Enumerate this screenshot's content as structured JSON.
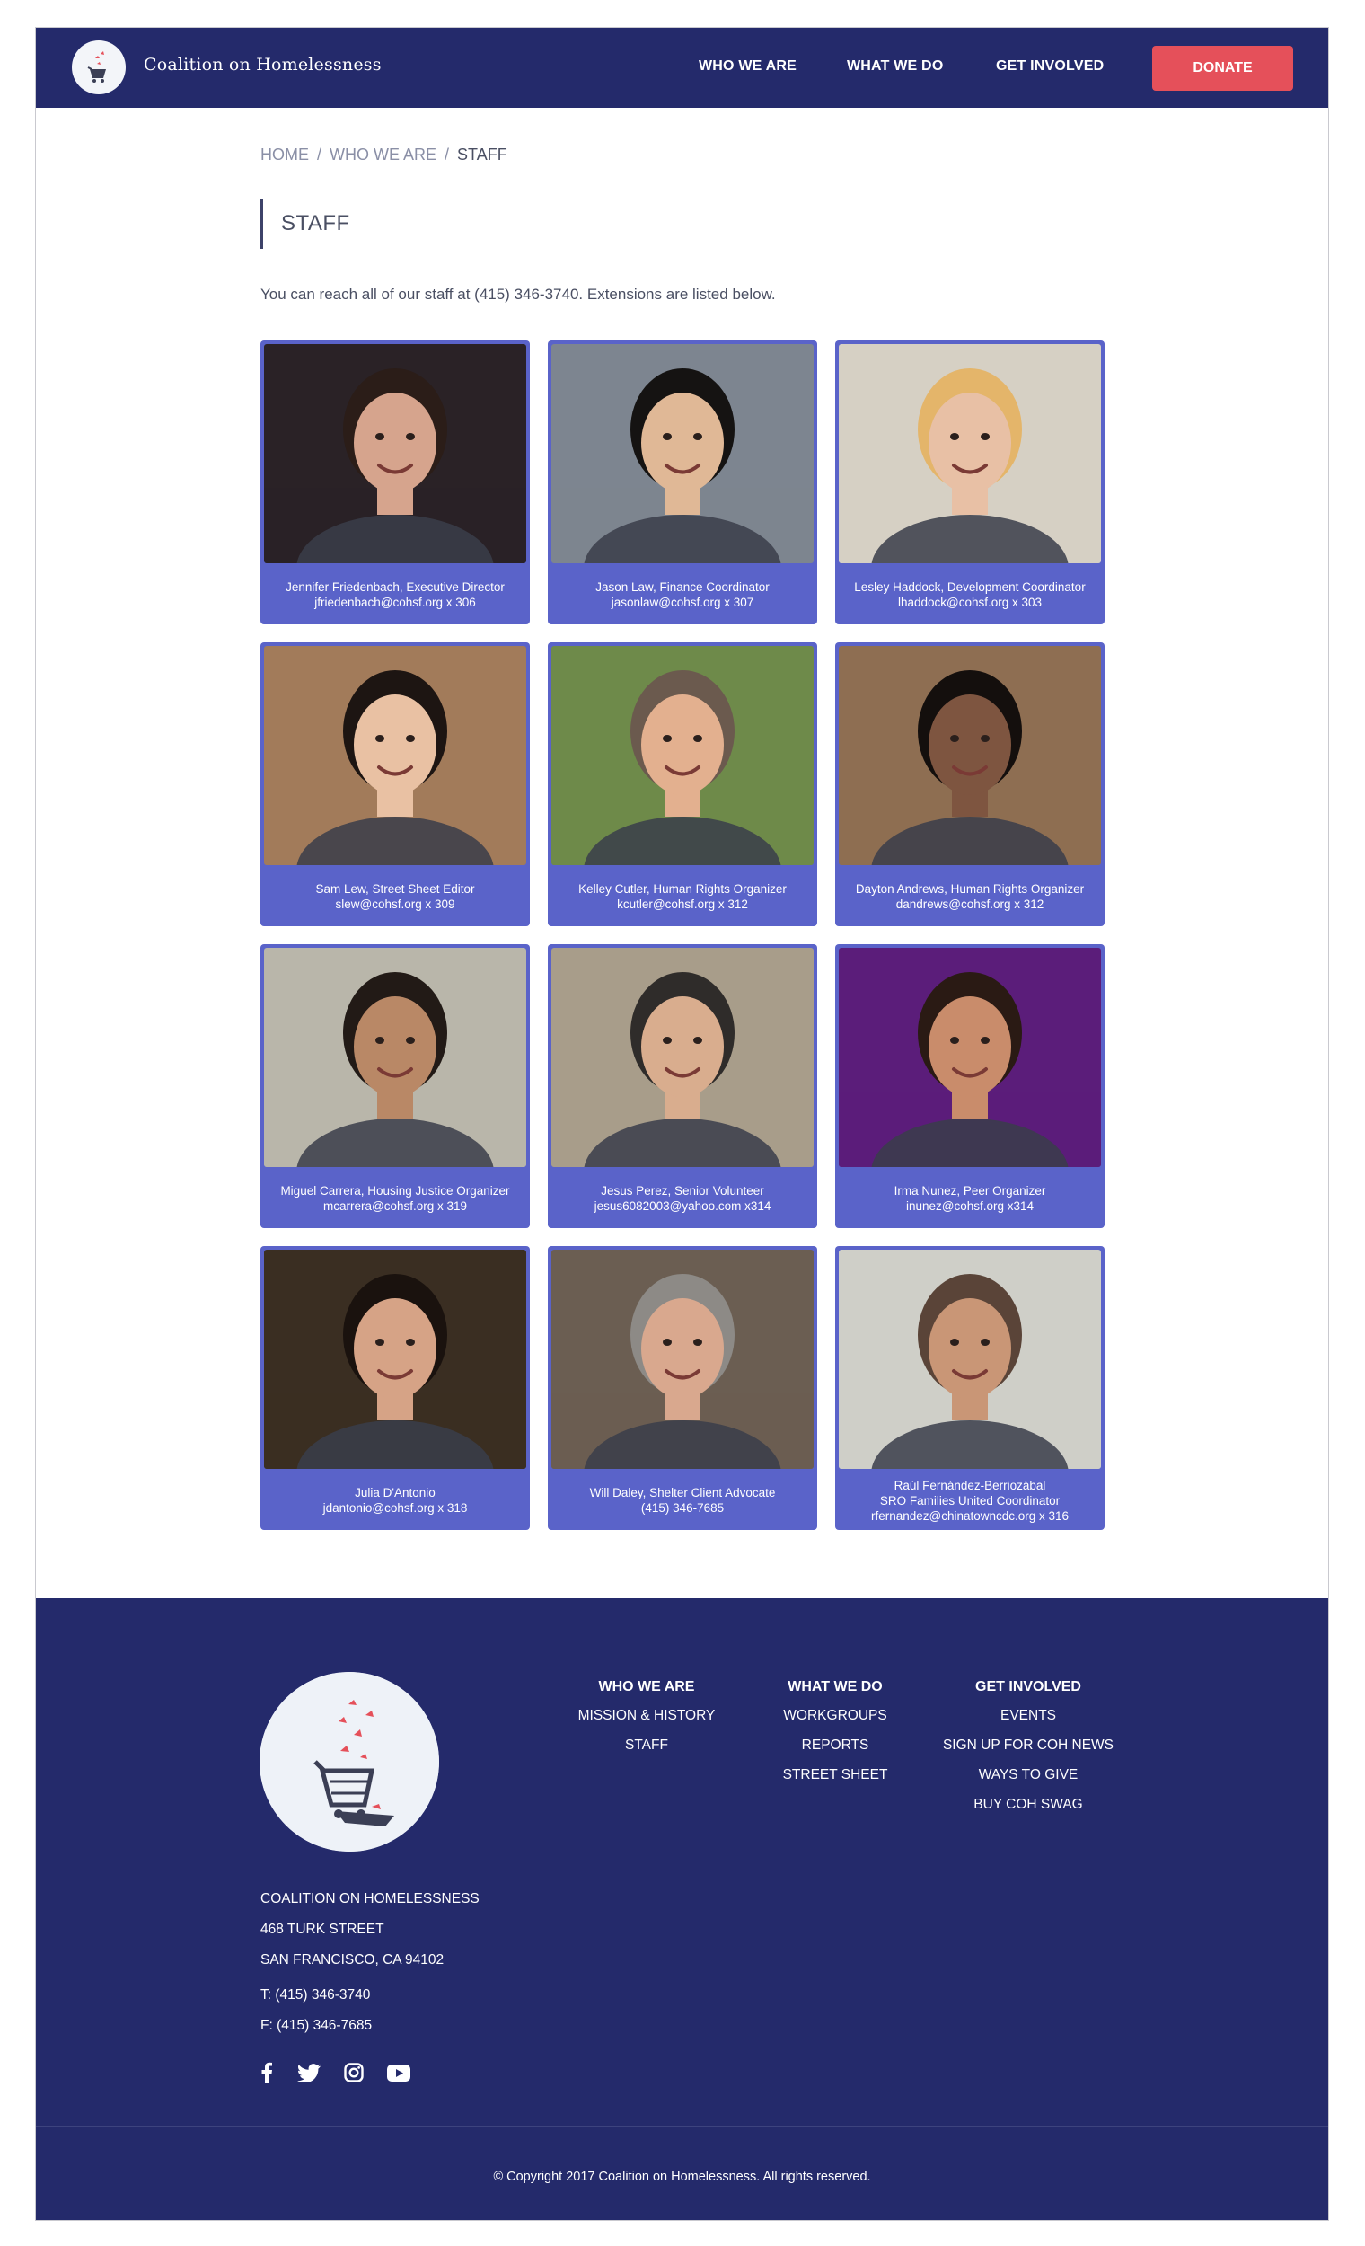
{
  "header": {
    "site_title": "Coalition on Homelessness",
    "nav": [
      "WHO WE ARE",
      "WHAT WE DO",
      "GET INVOLVED"
    ],
    "donate_label": "DONATE"
  },
  "breadcrumb": {
    "home": "HOME",
    "who": "WHO WE ARE",
    "current": "STAFF"
  },
  "page": {
    "title": "STAFF",
    "intro": "You can reach all of our staff at (415) 346-3740. Extensions are listed below."
  },
  "staff": [
    {
      "line1": "Jennifer Friedenbach, Executive Director",
      "line2": "jfriedenbach@cohsf.org x 306",
      "line3": "",
      "bg": "#2a2226",
      "skin": "#d6a48d",
      "hair": "#2b1d18"
    },
    {
      "line1": "Jason Law, Finance Coordinator",
      "line2": "jasonlaw@cohsf.org x 307",
      "line3": "",
      "bg": "#7d8590",
      "skin": "#e0b896",
      "hair": "#151312"
    },
    {
      "line1": "Lesley Haddock, Development Coordinator",
      "line2": "lhaddock@cohsf.org x 303",
      "line3": "",
      "bg": "#d6d0c4",
      "skin": "#e8c0a5",
      "hair": "#e4b56a"
    },
    {
      "line1": "Sam Lew, Street Sheet Editor",
      "line2": "slew@cohsf.org x 309",
      "line3": "",
      "bg": "#a27b5a",
      "skin": "#e9c1a3",
      "hair": "#1d1512"
    },
    {
      "line1": "Kelley Cutler, Human Rights  Organizer",
      "line2": "kcutler@cohsf.org x 312",
      "line3": "",
      "bg": "#6e8a4a",
      "skin": "#e3b08f",
      "hair": "#6b5a4e"
    },
    {
      "line1": "Dayton Andrews, Human Rights Organizer",
      "line2": "dandrews@cohsf.org x 312",
      "line3": "",
      "bg": "#8e6e52",
      "skin": "#7e5540",
      "hair": "#140f0d"
    },
    {
      "line1": "Miguel Carrera, Housing Justice Organizer",
      "line2": "mcarrera@cohsf.org x 319",
      "line3": "",
      "bg": "#b9b6aa",
      "skin": "#b98866",
      "hair": "#221a16"
    },
    {
      "line1": "Jesus Perez, Senior Volunteer",
      "line2": "jesus6082003@yahoo.com x314",
      "line3": "",
      "bg": "#a89d8a",
      "skin": "#d9ad8e",
      "hair": "#2f2c2a"
    },
    {
      "line1": "Irma Nunez, Peer Organizer",
      "line2": "inunez@cohsf.org x314",
      "line3": "",
      "bg": "#5b1d7a",
      "skin": "#c98c6b",
      "hair": "#2a1a14"
    },
    {
      "line1": "Julia D'Antonio",
      "line2": "jdantonio@cohsf.org x 318",
      "line3": "",
      "bg": "#3a2e22",
      "skin": "#d6a386",
      "hair": "#1a120e"
    },
    {
      "line1": "Will Daley, Shelter Client Advocate",
      "line2": "(415) 346-7685",
      "line3": "",
      "bg": "#6b5e52",
      "skin": "#d9a88e",
      "hair": "#8d8a86"
    },
    {
      "line1": "Raúl Fernández-Berriozábal",
      "line2": "SRO Families United Coordinator",
      "line3": "rfernandez@chinatowncdc.org x 316",
      "bg": "#cfcfc8",
      "skin": "#c99676",
      "hair": "#5a4438"
    }
  ],
  "footer": {
    "columns": [
      {
        "head": "WHO WE ARE",
        "items": [
          "MISSION & HISTORY",
          "STAFF"
        ]
      },
      {
        "head": "WHAT WE DO",
        "items": [
          "WORKGROUPS",
          "REPORTS",
          "STREET SHEET"
        ]
      },
      {
        "head": "GET INVOLVED",
        "items": [
          "EVENTS",
          "SIGN UP FOR COH NEWS",
          "WAYS TO GIVE",
          "BUY COH SWAG"
        ]
      }
    ],
    "org_name": "COALITION ON HOMELESSNESS",
    "street": "468 TURK STREET",
    "city": "SAN FRANCISCO, CA 94102",
    "phone": "T: (415) 346-3740",
    "fax": "F: (415) 346-7685",
    "social": [
      "facebook-icon",
      "twitter-icon",
      "instagram-icon",
      "youtube-icon"
    ],
    "copyright": "© Copyright 2017 Coalition on Homelessness.  All rights reserved."
  },
  "colors": {
    "navy": "#242a6b",
    "card": "#5a63c9",
    "donate": "#e5505a"
  }
}
